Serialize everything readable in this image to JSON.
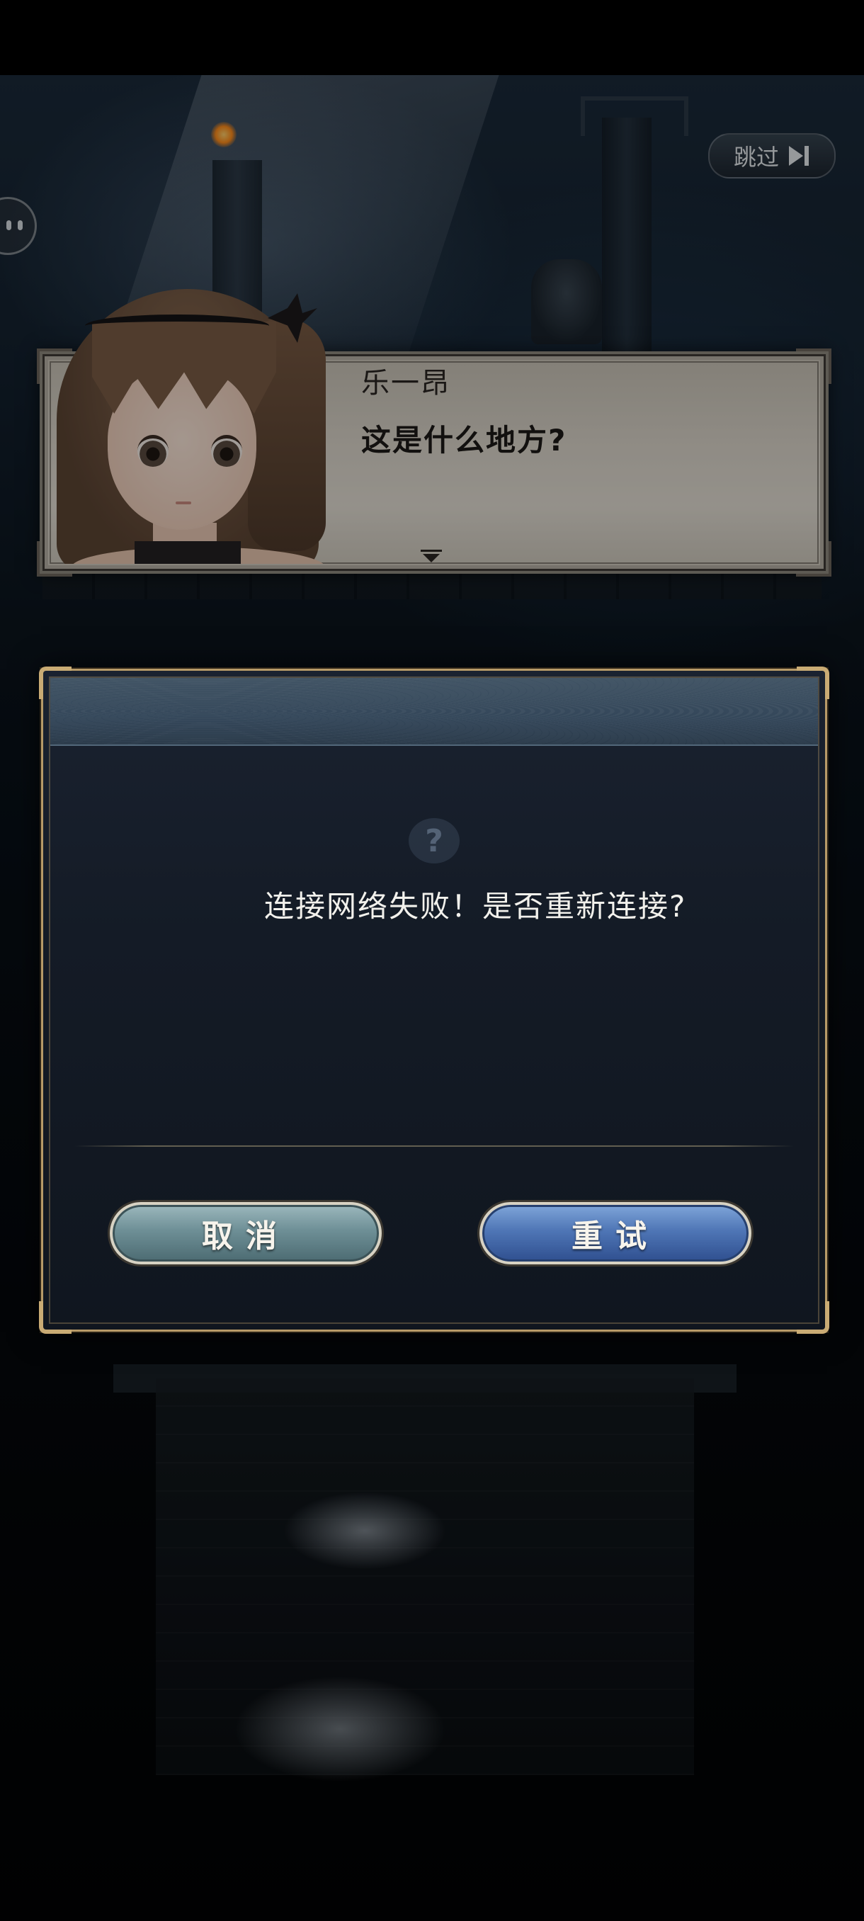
{
  "topbar": {
    "skip_label": "跳过",
    "skip_icon": "skip-forward-icon",
    "side_icon": "chat-bubble-icon"
  },
  "dialogue": {
    "speaker": "乐一昂",
    "text": "这是什么地方?"
  },
  "modal": {
    "message": "连接网络失败！是否重新连接?",
    "cancel_label": "取消",
    "retry_label": "重试",
    "watermark_icon": "question-icon"
  },
  "colors": {
    "frame_gold": "#b79a68",
    "cancel_teal": "#6e8f96",
    "retry_blue": "#4f76b6",
    "dialogue_parchment": "#dcd6cb"
  }
}
